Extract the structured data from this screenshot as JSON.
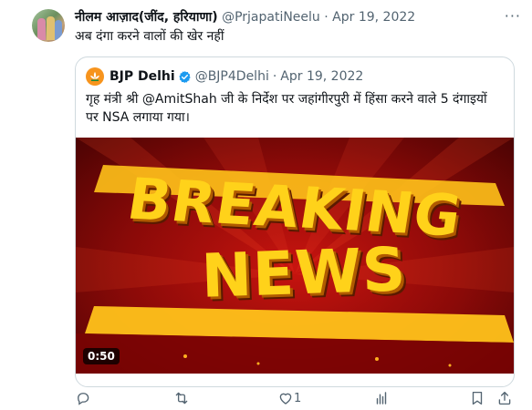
{
  "tweet": {
    "author_name": "नीलम आज़ाद(जींद, हरियाणा)",
    "author_handle": "@PrjapatiNeelu",
    "separator": "·",
    "date": "Apr 19, 2022",
    "text": "अब दंगा करने वालों की खेर नहीं",
    "more_icon": "more-icon"
  },
  "quoted": {
    "author_name": "BJP Delhi",
    "author_handle": "@BJP4Delhi",
    "separator": "·",
    "date": "Apr 19, 2022",
    "text_line1": "गृह मंत्री श्री @AmitShah जी के निर्देश पर जहांगीरपुरी में हिंसा करने वाले 5 दंगाइयों",
    "text_line2": "पर NSA लगाया गया।",
    "media": {
      "headline_line1": "BREAKING",
      "headline_line2": "NEWS",
      "duration": "0:50"
    }
  },
  "actions": {
    "reply_count": "",
    "retweet_count": "",
    "like_count": "1",
    "views_count": "",
    "icons": [
      "reply-icon",
      "retweet-icon",
      "like-icon",
      "views-icon",
      "bookmark-icon",
      "share-icon"
    ]
  },
  "colors": {
    "muted": "#536471",
    "verified_blue": "#1d9bf0",
    "border": "#cfd9de",
    "breaking_yellow": "#ffd21a",
    "breaking_red": "#c8140f"
  }
}
